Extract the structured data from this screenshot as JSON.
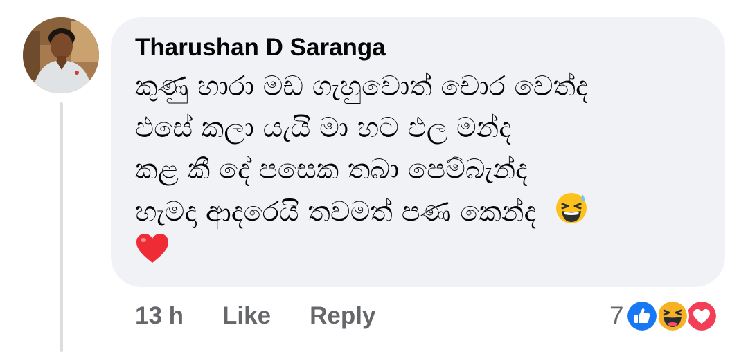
{
  "comment": {
    "author": "Tharushan D Saranga",
    "lines": [
      "කුණු හාරා මඩ ගැහුවොත් චොර වෙත්ද",
      "එසේ කලා යැයි මා හට ඵල මන්ද",
      "කළ කී දේ පසෙක තබා පෙම්බැන්ද",
      "හැමදා ආදරෙයි තවමත් පණ කෙන්ද"
    ],
    "emoji_inline": "grinning-squinting-sweat-emoji",
    "emoji_second_line": "red-heart-emoji"
  },
  "actions": {
    "time": "13 h",
    "like": "Like",
    "reply": "Reply"
  },
  "reactions": {
    "count": "7",
    "icons": [
      "like-reaction-icon",
      "haha-reaction-icon",
      "love-reaction-icon"
    ]
  },
  "colors": {
    "bubble": "#f0f2f5",
    "text": "#050505",
    "secondary": "#65676b",
    "like_blue": "#1877f2",
    "love_red": "#f33e58",
    "haha_yellow": "#f7b125"
  }
}
